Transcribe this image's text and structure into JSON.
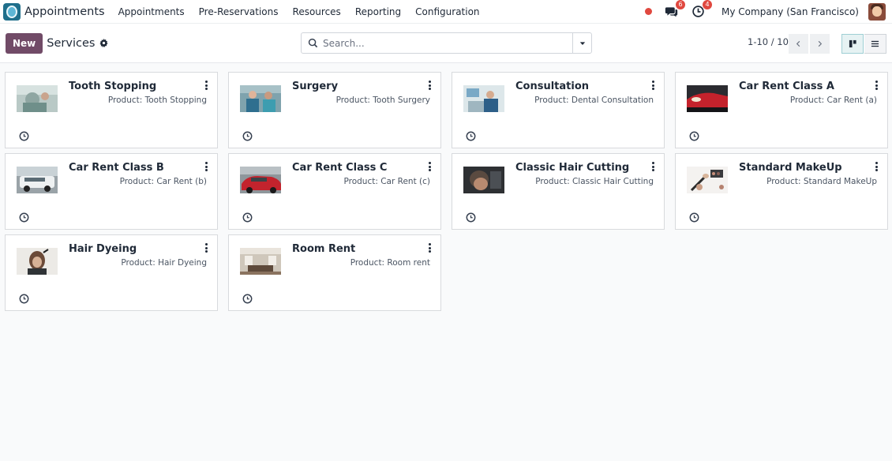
{
  "navbar": {
    "app_name": "Appointments",
    "menu": [
      "Appointments",
      "Pre-Reservations",
      "Resources",
      "Reporting",
      "Configuration"
    ],
    "messages_count": "6",
    "activities_count": "4",
    "company": "My Company (San Francisco)"
  },
  "control": {
    "new_label": "New",
    "breadcrumb": "Services",
    "search_placeholder": "Search...",
    "pager": "1-10 / 10"
  },
  "cards": [
    {
      "title": "Tooth Stopping",
      "subtitle": "Product: Tooth Stopping",
      "image": "dental-patient-photo"
    },
    {
      "title": "Surgery",
      "subtitle": "Product: Tooth Surgery",
      "image": "dental-surgery-photo"
    },
    {
      "title": "Consultation",
      "subtitle": "Product: Dental Consultation",
      "image": "dental-consultation-photo"
    },
    {
      "title": "Car Rent Class A",
      "subtitle": "Product: Car Rent (a)",
      "image": "red-car-photo"
    },
    {
      "title": "Car Rent Class B",
      "subtitle": "Product: Car Rent (b)",
      "image": "white-suv-photo"
    },
    {
      "title": "Car Rent Class C",
      "subtitle": "Product: Car Rent (c)",
      "image": "red-sedan-photo"
    },
    {
      "title": "Classic Hair Cutting",
      "subtitle": "Product: Classic Hair Cutting",
      "image": "haircut-photo"
    },
    {
      "title": "Standard MakeUp",
      "subtitle": "Product: Standard MakeUp",
      "image": "makeup-brushes-photo"
    },
    {
      "title": "Hair Dyeing",
      "subtitle": "Product: Hair Dyeing",
      "image": "hair-dyeing-photo"
    },
    {
      "title": "Room Rent",
      "subtitle": "Product: Room rent",
      "image": "room-interior-photo"
    }
  ],
  "colors": {
    "brand": "#714b67",
    "badge": "#e0483f"
  }
}
